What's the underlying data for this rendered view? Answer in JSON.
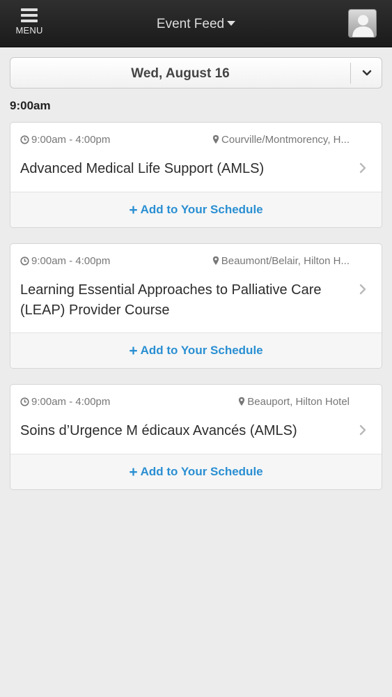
{
  "header": {
    "menu_label": "MENU",
    "title": "Event Feed"
  },
  "date_selector": {
    "date": "Wed, August 16"
  },
  "time_heading": "9:00am",
  "events": [
    {
      "time": "9:00am - 4:00pm",
      "location": "Courville/Montmorency, H...",
      "title": "Advanced Medical Life Support (AMLS)",
      "add_label": "Add to Your Schedule"
    },
    {
      "time": "9:00am - 4:00pm",
      "location": "Beaumont/Belair, Hilton H...",
      "title": "Learning Essential Approaches to Palliative Care (LEAP) Provider Course",
      "add_label": "Add to Your Schedule"
    },
    {
      "time": "9:00am - 4:00pm",
      "location": "Beauport, Hilton Hotel",
      "title": "Soins d’Urgence M édicaux Avancés (AMLS)",
      "add_label": "Add to Your Schedule"
    }
  ],
  "colors": {
    "accent": "#2a8fd2",
    "topbar": "#1f1f1f",
    "background": "#ececec"
  },
  "icons": [
    "hamburger-icon",
    "caret-down-icon",
    "user-avatar-icon",
    "chevron-down-icon",
    "clock-icon",
    "map-pin-icon",
    "chevron-right-icon",
    "plus-icon"
  ]
}
